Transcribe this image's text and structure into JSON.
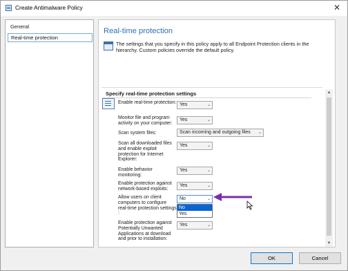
{
  "window": {
    "title": "Create Antimalware Policy",
    "close_glyph": "✕",
    "icon": "policy-icon"
  },
  "nav": {
    "items": [
      {
        "label": "General"
      },
      {
        "label": "Real-time protection",
        "selected": true
      }
    ]
  },
  "main": {
    "title": "Real-time protection",
    "description": "The settings that you specify in this policy apply to all Endpoint Protection clients in the hierarchy. Custom policies override the default policy.",
    "section_header": "Specify real-time protection settings",
    "settings": [
      {
        "label": "Enable real-time protection:",
        "value": "Yes"
      },
      {
        "label": "Monitor file and program activity on your computer:",
        "value": "Yes"
      },
      {
        "label": "Scan system files:",
        "value": "Scan incoming and outgoing files"
      },
      {
        "label": "Scan all downloaded files and enable exploit protection for Internet Explorer:",
        "value": "Yes"
      },
      {
        "label": "Enable behavior monitoring:",
        "value": "Yes"
      },
      {
        "label": "Enable protection against network-based exploits:",
        "value": "Yes"
      },
      {
        "label": "Allow users on client computers to configure real-time protection settings :",
        "value": "No",
        "dropdown_open": true,
        "options": [
          "No",
          "Yes"
        ]
      },
      {
        "label": "Enable protection against Potentially Unwanted Applications at download and prior to installation:",
        "value": "Yes"
      }
    ],
    "arrow_glyph": "⌵",
    "scroll_up_glyph": "▲",
    "scroll_down_glyph": "▼"
  },
  "footer": {
    "ok_label": "OK",
    "cancel_label": "Cancel"
  },
  "colors": {
    "accent_title": "#2f6fb3",
    "selection": "#0a64d6",
    "annotation_arrow": "#7a2ea8"
  }
}
